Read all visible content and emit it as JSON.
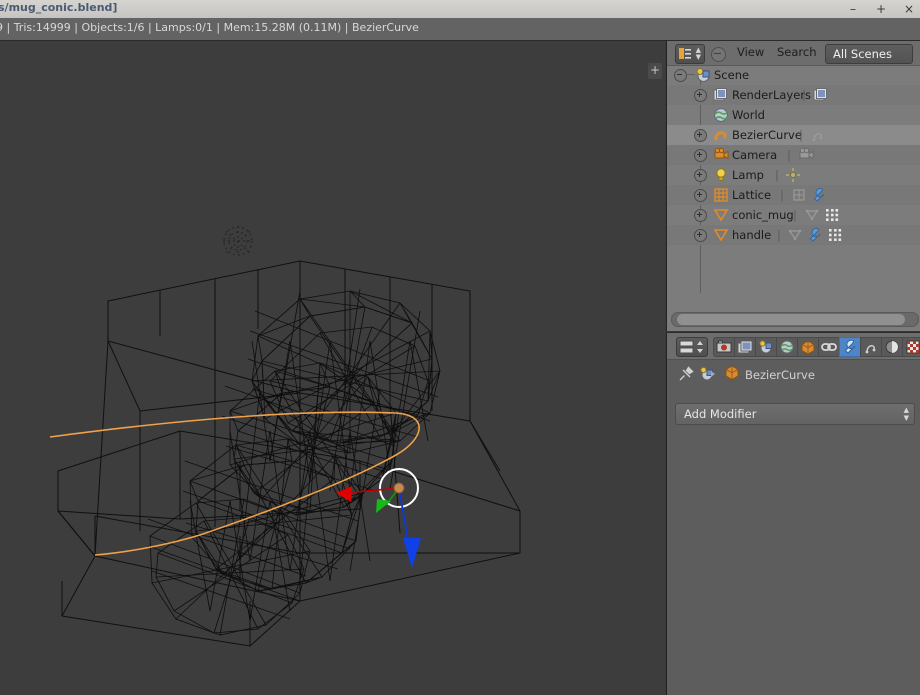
{
  "window": {
    "title": "s/mug_conic.blend]",
    "buttons": {
      "minimize": "–",
      "maximize": "+",
      "close": "×"
    }
  },
  "statusbar": {
    "text": "9 | Tris:14999 | Objects:1/6 | Lamps:0/1 | Mem:15.28M (0.11M) | BezierCurve",
    "verts_partial": "9",
    "tris": "Tris:14999",
    "objects": "Objects:1/6",
    "lamps": "Lamps:0/1",
    "memory": "Mem:15.28M (0.11M)",
    "active_object": "BezierCurve"
  },
  "viewport": {
    "editor": "3D View",
    "background_color": "#3d3d3d",
    "wireframe_color": "#0d0d0d",
    "curve_color": "#f0a24a",
    "region_toggle": "+",
    "manipulator": {
      "type": "translate",
      "x_axis_color": "#e00000",
      "y_axis_color": "#00b000",
      "z_axis_color": "#1040e0",
      "center_color": "#c48a52"
    }
  },
  "outliner": {
    "header": {
      "editor_type": "Outliner",
      "collapse_label": "",
      "menus": [
        "View",
        "Search"
      ],
      "view_label": "View",
      "search_label": "Search",
      "display_mode": "All Scenes"
    },
    "rows": [
      {
        "label": "Scene",
        "indent": 0,
        "expander": "minus",
        "icon": "scene-icon",
        "datablocks": [],
        "eye": null,
        "select": null,
        "render": null
      },
      {
        "label": "RenderLayers",
        "indent": 1,
        "expander": "plus",
        "icon": "renderlayers-icon",
        "datablocks": [
          "renderlayers-data-icon"
        ],
        "eye": null,
        "select": null,
        "render": null
      },
      {
        "label": "World",
        "indent": 1,
        "expander": "none",
        "icon": "world-icon",
        "datablocks": [],
        "eye": null,
        "select": null,
        "render": null
      },
      {
        "label": "BezierCurve",
        "indent": 1,
        "expander": "plus",
        "icon": "curve-icon",
        "datablocks": [
          "curve-data-icon"
        ],
        "eye": "open",
        "select": "arrow",
        "render": "camera"
      },
      {
        "label": "Camera",
        "indent": 1,
        "expander": "plus",
        "icon": "camera-icon",
        "datablocks": [
          "camera-data-icon"
        ],
        "eye": "open",
        "select": "arrow",
        "render": "camera"
      },
      {
        "label": "Lamp",
        "indent": 1,
        "expander": "plus",
        "icon": "lamp-icon",
        "datablocks": [
          "lamp-data-icon"
        ],
        "eye": "open",
        "select": "arrow",
        "render": "camera"
      },
      {
        "label": "Lattice",
        "indent": 1,
        "expander": "plus",
        "icon": "lattice-icon",
        "datablocks": [
          "lattice-data-icon",
          "wrench-icon"
        ],
        "eye": "open",
        "select": "arrow",
        "render": "camera"
      },
      {
        "label": "conic_mug",
        "indent": 1,
        "expander": "plus",
        "icon": "mesh-icon",
        "datablocks": [
          "mesh-data-icon",
          "vertexgroup-icon"
        ],
        "eye": "closed",
        "select": "arrow",
        "render": "camera"
      },
      {
        "label": "handle",
        "indent": 1,
        "expander": "plus",
        "icon": "mesh-icon",
        "datablocks": [
          "mesh-data-icon",
          "wrench-icon",
          "vertexgroup-icon"
        ],
        "eye": "open",
        "select": "arrow",
        "render": "camera"
      }
    ],
    "selected_row": "BezierCurve"
  },
  "properties": {
    "editor_type": "Properties",
    "tabs": [
      {
        "name": "render-tab",
        "icon": "camera-back-icon",
        "active": false
      },
      {
        "name": "renderlayers-tab",
        "icon": "images-icon",
        "active": false
      },
      {
        "name": "scene-tab",
        "icon": "scene-icon",
        "active": false
      },
      {
        "name": "world-tab",
        "icon": "world-icon",
        "active": false
      },
      {
        "name": "object-tab",
        "icon": "cube-icon",
        "active": false
      },
      {
        "name": "constraints-tab",
        "icon": "chain-icon",
        "active": false
      },
      {
        "name": "modifiers-tab",
        "icon": "wrench-icon",
        "active": true
      },
      {
        "name": "data-tab",
        "icon": "curve-data-icon",
        "active": false
      },
      {
        "name": "material-tab",
        "icon": "sphere-icon",
        "active": false
      },
      {
        "name": "texture-tab",
        "icon": "checker-icon",
        "active": false
      }
    ],
    "active_tab": "modifiers-tab",
    "accent_color": "#4e85c6",
    "breadcrumb": {
      "pin": "pin-icon",
      "scene": "scene-icon",
      "object_icon": "cube-icon",
      "object_name": "BezierCurve"
    },
    "add_modifier_label": "Add Modifier"
  }
}
